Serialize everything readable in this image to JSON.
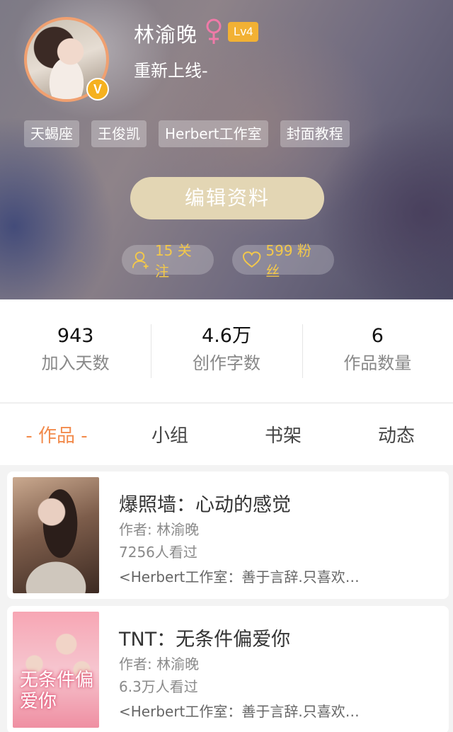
{
  "profile": {
    "username": "林渝晚",
    "level": "Lv4",
    "signature": "重新上线-",
    "verified_badge": "V",
    "tags": [
      "天蝎座",
      "王俊凯",
      "Herbert工作室",
      "封面教程"
    ],
    "edit_button": "编辑资料",
    "following": "15 关注",
    "fans": "599 粉丝"
  },
  "stats": [
    {
      "value": "943",
      "label": "加入天数"
    },
    {
      "value": "4.6万",
      "label": "创作字数"
    },
    {
      "value": "6",
      "label": "作品数量"
    }
  ],
  "tabs": [
    {
      "label": "- 作品 -",
      "active": true
    },
    {
      "label": "小组",
      "active": false
    },
    {
      "label": "书架",
      "active": false
    },
    {
      "label": "动态",
      "active": false
    }
  ],
  "works": [
    {
      "title": "爆照墙：心动的感觉",
      "author": "作者: 林渝晚",
      "views": "7256人看过",
      "desc": "<Herbert工作室：善于言辞.只喜欢…"
    },
    {
      "title": "TNT：无条件偏爱你",
      "author": "作者: 林渝晚",
      "views": "6.3万人看过",
      "desc": "<Herbert工作室：善于言辞.只喜欢…",
      "cover_text": "无条件偏爱你"
    }
  ],
  "colors": {
    "accent": "#f28a4b",
    "gold": "#f3c84a",
    "level_badge": "#f2b134",
    "female_icon": "#f07aa8",
    "edit_button": "#e3d6b4"
  }
}
